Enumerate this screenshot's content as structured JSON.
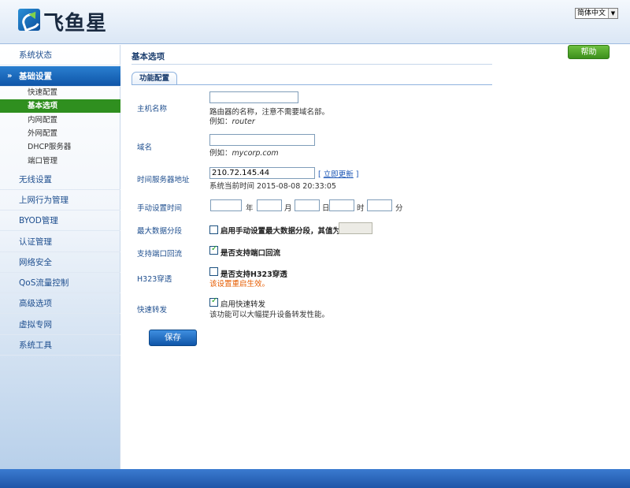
{
  "header": {
    "logo_text": "飞鱼星",
    "language": "简体中文"
  },
  "sidebar": {
    "items": [
      {
        "label": "系统状态"
      },
      {
        "label": "基础设置"
      },
      {
        "label": "无线设置"
      },
      {
        "label": "上网行为管理"
      },
      {
        "label": "BYOD管理"
      },
      {
        "label": "认证管理"
      },
      {
        "label": "网络安全"
      },
      {
        "label": "QoS流量控制"
      },
      {
        "label": "高级选项"
      },
      {
        "label": "虚拟专网"
      },
      {
        "label": "系统工具"
      }
    ],
    "sub_items": [
      {
        "label": "快速配置"
      },
      {
        "label": "基本选项"
      },
      {
        "label": "内网配置"
      },
      {
        "label": "外网配置"
      },
      {
        "label": "DHCP服务器"
      },
      {
        "label": "端口管理"
      }
    ]
  },
  "main": {
    "title": "基本选项",
    "help_label": "帮助",
    "tab_label": "功能配置",
    "hostname": {
      "label": "主机名称",
      "value": "",
      "hint": "路由器的名称，注意不需要域名部。",
      "example_prefix": "例如：",
      "example_value": "router"
    },
    "domain": {
      "label": "域名",
      "value": "",
      "example_prefix": "例如：",
      "example_value": "mycorp.com"
    },
    "ntp": {
      "label": "时间服务器地址",
      "value": "210.72.145.44",
      "update_link": "立即更新",
      "current_time_label": "系统当前时间",
      "current_time": "2015-08-08 20:33:05"
    },
    "manual_time": {
      "label": "手动设置时间",
      "units": [
        "年",
        "月",
        "日",
        "时",
        "分"
      ]
    },
    "mss": {
      "label": "最大数据分段",
      "checkbox_label": "启用手动设置最大数据分段，其值为：",
      "checked": false,
      "value": ""
    },
    "loopback": {
      "label": "支持端口回流",
      "checkbox_label": "是否支持端口回流",
      "checked": true
    },
    "h323": {
      "label": "H323穿透",
      "checkbox_label": "是否支持H323穿透",
      "checked": false,
      "warning": "该设置重启生效。"
    },
    "fast_forward": {
      "label": "快速转发",
      "checkbox_label": "启用快速转发",
      "checked": true,
      "hint": "该功能可以大幅提升设备转发性能。"
    },
    "save_label": "保存"
  }
}
